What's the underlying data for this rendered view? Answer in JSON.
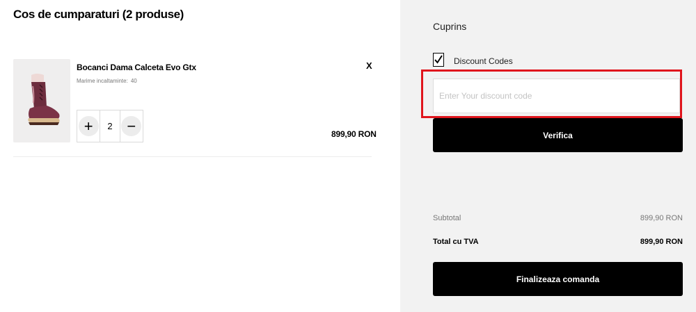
{
  "cart": {
    "title": "Cos de cumparaturi (2 produse)",
    "item": {
      "name": "Bocanci Dama Calceta Evo Gtx",
      "size_label": "Marime incaltaminte:",
      "size_value": "40",
      "quantity": "2",
      "price": "899,90 RON",
      "remove_label": "X",
      "plus_label": "+",
      "minus_label": "−",
      "image_icon": "boot-image"
    }
  },
  "summary": {
    "title": "Cuprins",
    "discount_checkbox_label": "Discount Codes",
    "discount_checked": true,
    "discount_placeholder": "Enter Your discount code",
    "verify_label": "Verifica",
    "subtotal_label": "Subtotal",
    "subtotal_value": "899,90 RON",
    "total_label": "Total cu TVA",
    "total_value": "899,90 RON",
    "checkout_label": "Finalizeaza comanda"
  },
  "colors": {
    "accent_highlight": "#e0151d",
    "panel_bg": "#f2f2f2",
    "button_bg": "#000000"
  }
}
